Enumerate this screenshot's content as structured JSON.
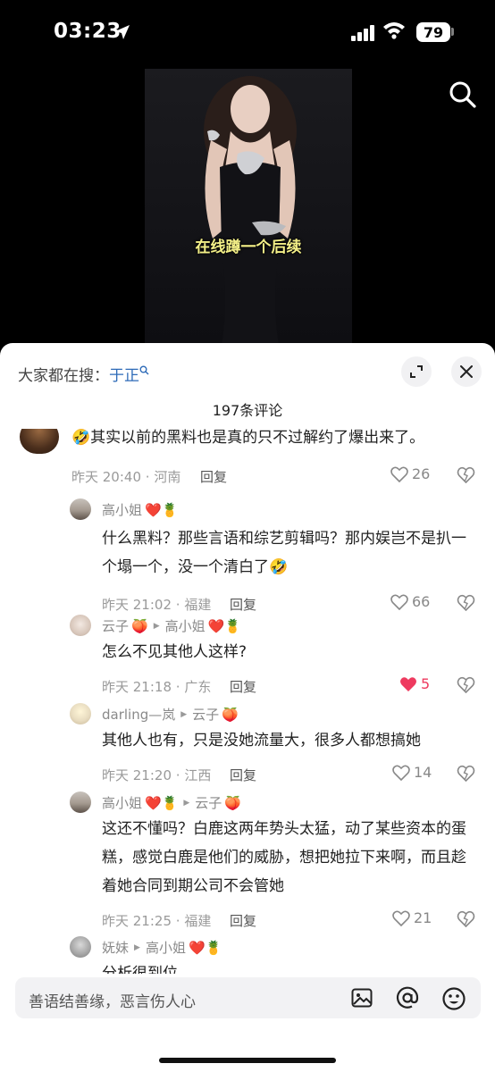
{
  "status_bar": {
    "time": "03:23",
    "battery": "79"
  },
  "video": {
    "subtitle": "在线蹲一个后续"
  },
  "sheet": {
    "search_prefix": "大家都在搜：",
    "search_keyword": "于正",
    "comment_count": "197条评论"
  },
  "comments": [
    {
      "text": "其实以前的黑料也是真的只不过解约了爆出来了。",
      "emoji_prefix": "🤣",
      "time": "昨天 20:40",
      "location": "河南",
      "reply": "回复",
      "likes": "26",
      "liked": false
    },
    {
      "name": "高小姐",
      "name_emoji": "❤️🍍",
      "text": "什么黑料？那些言语和综艺剪辑吗？那内娱岂不是扒一个塌一个，没一个清白了🤣",
      "time": "昨天 21:02",
      "location": "福建",
      "reply": "回复",
      "likes": "66",
      "liked": false
    },
    {
      "name": "云子",
      "name_emoji": "🍑",
      "reply_to": "高小姐",
      "reply_to_emoji": "❤️🍍",
      "text": "怎么不见其他人这样?",
      "time": "昨天 21:18",
      "location": "广东",
      "reply": "回复",
      "likes": "5",
      "liked": true
    },
    {
      "name": "darling—岚",
      "name_emoji": "",
      "reply_to": "云子",
      "reply_to_emoji": "🍑",
      "text": "其他人也有，只是没她流量大，很多人都想搞她",
      "time": "昨天 21:20",
      "location": "江西",
      "reply": "回复",
      "likes": "14",
      "liked": false
    },
    {
      "name": "高小姐",
      "name_emoji": "❤️🍍",
      "reply_to": "云子",
      "reply_to_emoji": "🍑",
      "text": "这还不懂吗？白鹿这两年势头太猛，动了某些资本的蛋糕，感觉白鹿是他们的威胁，想把她拉下来啊，而且趁着她合同到期公司不会管她",
      "time": "昨天 21:25",
      "location": "福建",
      "reply": "回复",
      "likes": "21",
      "liked": false
    },
    {
      "name": "妩妹",
      "name_emoji": "",
      "reply_to": "高小姐",
      "reply_to_emoji": "❤️🍍",
      "text": "分析很到位"
    }
  ],
  "input": {
    "placeholder": "善语结善缘，恶言伤人心"
  },
  "colors": {
    "link": "#2e6bb8",
    "like_active": "#ee3a5f",
    "subtitle": "#f4f088"
  }
}
